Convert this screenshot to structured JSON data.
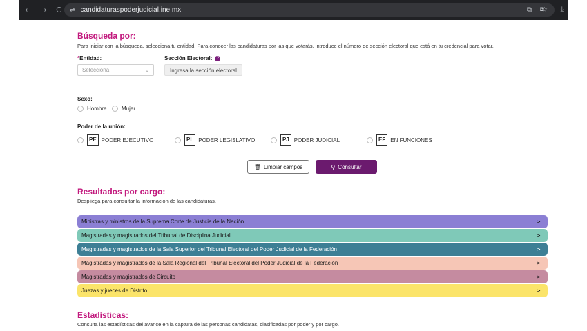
{
  "browser": {
    "url": "candidaturaspoderjudicial.ine.mx",
    "back_icon": "←",
    "forward_icon": "→",
    "reload_icon": "C",
    "tune_icon": "⇌",
    "cast_icon": "⧉",
    "star_icon": "☆",
    "extensions_icon": "⧈",
    "download_icon": "⤓"
  },
  "search": {
    "title": "Búsqueda por:",
    "subtitle": "Para iniciar con la búsqueda, selecciona tu entidad. Para conocer las candidaturas por las que votarás, introduce el número de sección electoral que está en tu credencial para votar.",
    "entidad_required": "*",
    "entidad_label": "Entidad:",
    "entidad_placeholder": "Selecciona",
    "seccion_label": "Sección Electoral:",
    "seccion_help": "?",
    "seccion_button": "Ingresa la sección electoral"
  },
  "sexo": {
    "label": "Sexo:",
    "options": [
      "Hombre",
      "Mujer"
    ]
  },
  "poder": {
    "label": "Poder de la unión:",
    "options": [
      {
        "abbr": "PE",
        "label": "PODER EJECUTIVO"
      },
      {
        "abbr": "PL",
        "label": "PODER LEGISLATIVO"
      },
      {
        "abbr": "PJ",
        "label": "PODER JUDICIAL"
      },
      {
        "abbr": "EF",
        "label": "EN FUNCIONES"
      }
    ]
  },
  "actions": {
    "clear_label": "Limpiar campos",
    "clear_icon": "🗑",
    "consult_label": "Consultar",
    "consult_icon": "⚲"
  },
  "results": {
    "title": "Resultados por cargo:",
    "subtitle": "Despliega para consultar la información de las candidaturas.",
    "items": [
      {
        "label": "Ministras y ministros de la Suprema Corte de Justicia de la Nación",
        "color": "#8b7fd4",
        "text_color": "#1a1a1a"
      },
      {
        "label": "Magistradas y magistrados del Tribunal de Disciplina Judicial",
        "color": "#7fc9b8",
        "text_color": "#1a1a1a"
      },
      {
        "label": "Magistradas y magistrados de la Sala Superior del Tribunal Electoral del Poder Judicial de la Federación",
        "color": "#3d7f95",
        "text_color": "#ffffff"
      },
      {
        "label": "Magistradas y magistrados de la Sala Regional del Tribunal Electoral del Poder Judicial de la Federación",
        "color": "#f6c6b6",
        "text_color": "#1a1a1a"
      },
      {
        "label": "Magistradas y magistrados de Circuito",
        "color": "#c58ba0",
        "text_color": "#1a1a1a"
      },
      {
        "label": "Juezas y jueces de Distrito",
        "color": "#fbe46a",
        "text_color": "#1a1a1a"
      }
    ],
    "arrow": ">"
  },
  "stats": {
    "title": "Estadísticas:",
    "subtitle": "Consulta las estadísticas del avance en la captura de las personas candidatas, clasificadas por poder y por cargo."
  },
  "colors": {
    "accent": "#c2187d",
    "primary_button": "#6b1a6e"
  }
}
